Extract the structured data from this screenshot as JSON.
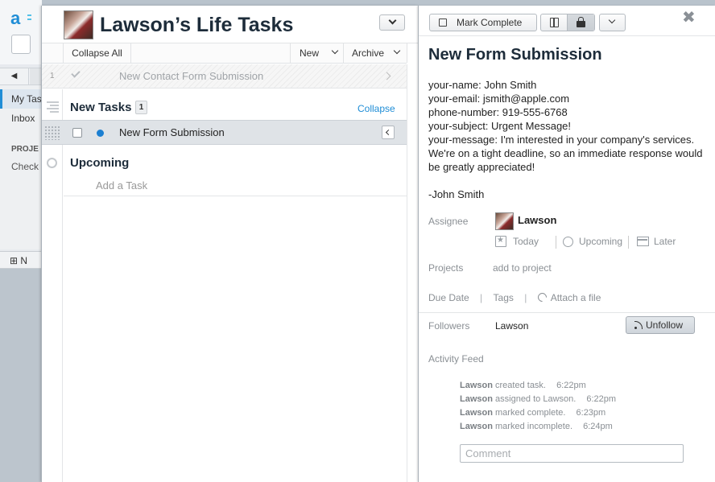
{
  "background_app": {
    "logo_glyph": "a",
    "nav_back": "◀",
    "sidebar_items": [
      {
        "label": "My Tasks"
      },
      {
        "label": "Inbox"
      }
    ],
    "projects_header": "PROJE",
    "check_item": "Check",
    "new_button": "N"
  },
  "list": {
    "title": "Lawson’s Life Tasks",
    "toolbar": {
      "collapse_all": "Collapse All",
      "new": "New",
      "archive": "Archive"
    },
    "completed_task": {
      "count": "1",
      "title": "New Contact Form Submission"
    },
    "sections": [
      {
        "title": "New Tasks",
        "count": "1",
        "collapse_label": "Collapse",
        "tasks": [
          {
            "title": "New Form Submission"
          }
        ]
      },
      {
        "title": "Upcoming",
        "add_task_placeholder": "Add a Task"
      }
    ]
  },
  "detail": {
    "toolbar": {
      "mark_complete": "Mark Complete",
      "close_glyph": "✖"
    },
    "title": "New Form Submission",
    "description_lines": [
      "your-name: John Smith",
      "your-email: jsmith@apple.com",
      "phone-number: 919-555-6768",
      "your-subject: Urgent Message!",
      "your-message: I'm interested in your company's services. We're on a tight deadline, so an immediate response would be greatly appreciated!"
    ],
    "signature": "-John Smith",
    "assignee": {
      "label": "Assignee",
      "name": "Lawson",
      "schedule": {
        "today": "Today",
        "upcoming": "Upcoming",
        "later": "Later"
      }
    },
    "projects": {
      "label": "Projects",
      "add": "add to project"
    },
    "meta": {
      "due_date": "Due Date",
      "tags": "Tags",
      "attach": "Attach a file"
    },
    "followers": {
      "label": "Followers",
      "name": "Lawson",
      "unfollow": "Unfollow"
    },
    "activity": {
      "label": "Activity Feed",
      "entries": [
        {
          "user": "Lawson",
          "action": "created task.",
          "time": "6:22pm"
        },
        {
          "user": "Lawson",
          "action": "assigned to Lawson.",
          "time": "6:22pm"
        },
        {
          "user": "Lawson",
          "action": "marked complete.",
          "time": "6:23pm"
        },
        {
          "user": "Lawson",
          "action": "marked incomplete.",
          "time": "6:24pm"
        }
      ]
    },
    "comment_placeholder": "Comment"
  },
  "colors": {
    "accent": "#1f8dd6",
    "task_dot": "#1b7fd1",
    "selected_row": "#dfe3e7",
    "title_text": "#1d2c3a"
  }
}
